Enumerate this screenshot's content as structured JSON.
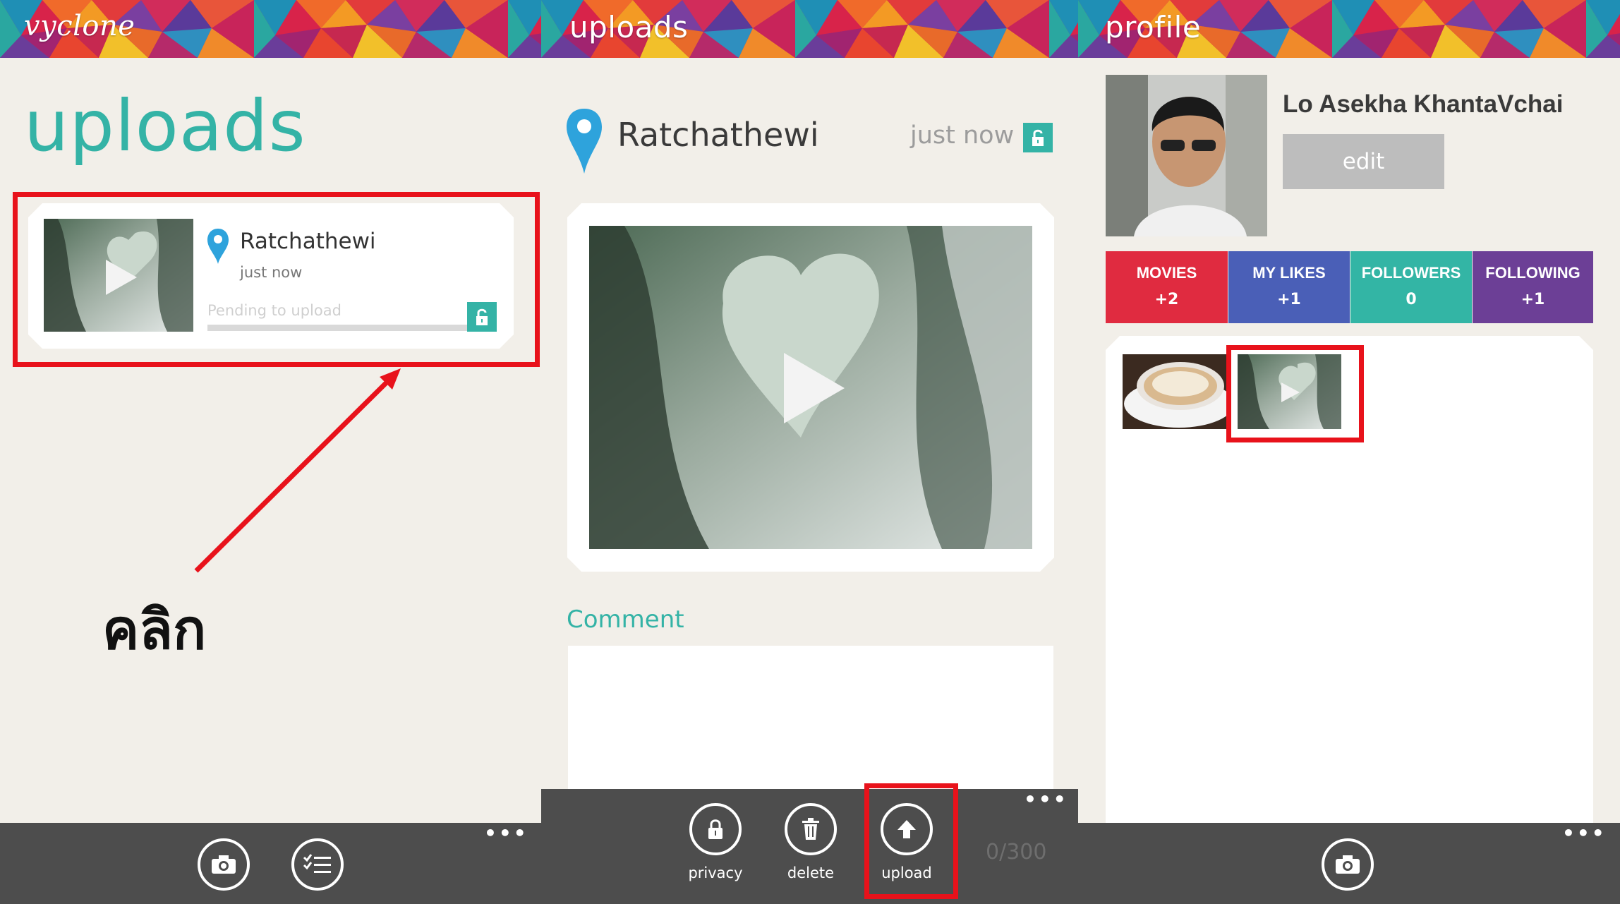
{
  "colors": {
    "teal": "#34b3a6",
    "red": "#e8121b",
    "bar": "#4d4d4d",
    "movies": "#e02b40",
    "likes": "#4a5fb7",
    "followers": "#33b5a5",
    "following": "#6c3f96"
  },
  "panel1": {
    "logo": "vyclone",
    "title": "uploads",
    "card": {
      "location": "Ratchathewi",
      "time": "just now",
      "status": "Pending to upload",
      "progress": 0
    },
    "annotation": "คลิก",
    "appbar": {
      "buttons": [
        {
          "icon": "camera-icon"
        },
        {
          "icon": "list-icon"
        }
      ],
      "more": "•••"
    }
  },
  "panel2": {
    "header": "uploads",
    "location": "Ratchathewi",
    "time": "just now",
    "comment_label": "Comment",
    "comment_placeholder": "",
    "char_count": "0/300",
    "appbar": {
      "buttons": [
        {
          "icon": "lock-icon",
          "label": "privacy"
        },
        {
          "icon": "trash-icon",
          "label": "delete"
        },
        {
          "icon": "upload-icon",
          "label": "upload"
        }
      ],
      "more": "•••"
    }
  },
  "panel3": {
    "header": "profile",
    "name": "Lo Asekha KhantaVchai",
    "edit_label": "edit",
    "stats": [
      {
        "label": "MOVIES",
        "value": "+2"
      },
      {
        "label": "MY LIKES",
        "value": "+1"
      },
      {
        "label": "FOLLOWERS",
        "value": "0"
      },
      {
        "label": "FOLLOWING",
        "value": "+1"
      }
    ],
    "appbar": {
      "buttons": [
        {
          "icon": "camera-icon"
        }
      ],
      "more": "•••"
    }
  }
}
